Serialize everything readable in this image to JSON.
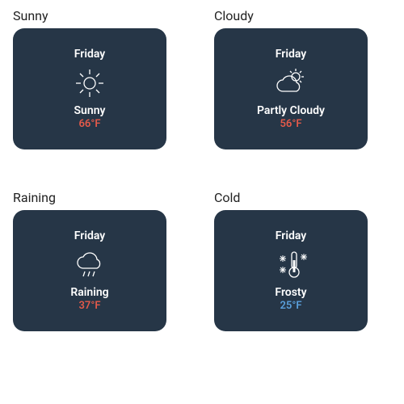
{
  "cards": [
    {
      "title": "Sunny",
      "day": "Friday",
      "condition": "Sunny",
      "temp": "66°F",
      "temp_class": "warm",
      "icon": "sun"
    },
    {
      "title": "Cloudy",
      "day": "Friday",
      "condition": "Partly Cloudy",
      "temp": "56°F",
      "temp_class": "warm",
      "icon": "partly-cloudy"
    },
    {
      "title": "Raining",
      "day": "Friday",
      "condition": "Raining",
      "temp": "37°F",
      "temp_class": "warm",
      "icon": "rain"
    },
    {
      "title": "Cold",
      "day": "Friday",
      "condition": "Frosty",
      "temp": "25°F",
      "temp_class": "cold",
      "icon": "frosty"
    }
  ]
}
